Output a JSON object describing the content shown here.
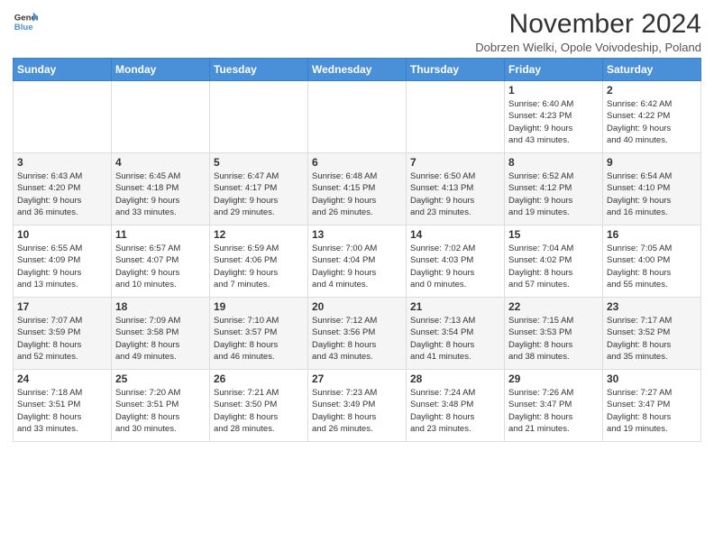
{
  "logo": {
    "line1": "General",
    "line2": "Blue"
  },
  "title": "November 2024",
  "subtitle": "Dobrzen Wielki, Opole Voivodeship, Poland",
  "days_of_week": [
    "Sunday",
    "Monday",
    "Tuesday",
    "Wednesday",
    "Thursday",
    "Friday",
    "Saturday"
  ],
  "weeks": [
    [
      {
        "day": "",
        "info": ""
      },
      {
        "day": "",
        "info": ""
      },
      {
        "day": "",
        "info": ""
      },
      {
        "day": "",
        "info": ""
      },
      {
        "day": "",
        "info": ""
      },
      {
        "day": "1",
        "info": "Sunrise: 6:40 AM\nSunset: 4:23 PM\nDaylight: 9 hours\nand 43 minutes."
      },
      {
        "day": "2",
        "info": "Sunrise: 6:42 AM\nSunset: 4:22 PM\nDaylight: 9 hours\nand 40 minutes."
      }
    ],
    [
      {
        "day": "3",
        "info": "Sunrise: 6:43 AM\nSunset: 4:20 PM\nDaylight: 9 hours\nand 36 minutes."
      },
      {
        "day": "4",
        "info": "Sunrise: 6:45 AM\nSunset: 4:18 PM\nDaylight: 9 hours\nand 33 minutes."
      },
      {
        "day": "5",
        "info": "Sunrise: 6:47 AM\nSunset: 4:17 PM\nDaylight: 9 hours\nand 29 minutes."
      },
      {
        "day": "6",
        "info": "Sunrise: 6:48 AM\nSunset: 4:15 PM\nDaylight: 9 hours\nand 26 minutes."
      },
      {
        "day": "7",
        "info": "Sunrise: 6:50 AM\nSunset: 4:13 PM\nDaylight: 9 hours\nand 23 minutes."
      },
      {
        "day": "8",
        "info": "Sunrise: 6:52 AM\nSunset: 4:12 PM\nDaylight: 9 hours\nand 19 minutes."
      },
      {
        "day": "9",
        "info": "Sunrise: 6:54 AM\nSunset: 4:10 PM\nDaylight: 9 hours\nand 16 minutes."
      }
    ],
    [
      {
        "day": "10",
        "info": "Sunrise: 6:55 AM\nSunset: 4:09 PM\nDaylight: 9 hours\nand 13 minutes."
      },
      {
        "day": "11",
        "info": "Sunrise: 6:57 AM\nSunset: 4:07 PM\nDaylight: 9 hours\nand 10 minutes."
      },
      {
        "day": "12",
        "info": "Sunrise: 6:59 AM\nSunset: 4:06 PM\nDaylight: 9 hours\nand 7 minutes."
      },
      {
        "day": "13",
        "info": "Sunrise: 7:00 AM\nSunset: 4:04 PM\nDaylight: 9 hours\nand 4 minutes."
      },
      {
        "day": "14",
        "info": "Sunrise: 7:02 AM\nSunset: 4:03 PM\nDaylight: 9 hours\nand 0 minutes."
      },
      {
        "day": "15",
        "info": "Sunrise: 7:04 AM\nSunset: 4:02 PM\nDaylight: 8 hours\nand 57 minutes."
      },
      {
        "day": "16",
        "info": "Sunrise: 7:05 AM\nSunset: 4:00 PM\nDaylight: 8 hours\nand 55 minutes."
      }
    ],
    [
      {
        "day": "17",
        "info": "Sunrise: 7:07 AM\nSunset: 3:59 PM\nDaylight: 8 hours\nand 52 minutes."
      },
      {
        "day": "18",
        "info": "Sunrise: 7:09 AM\nSunset: 3:58 PM\nDaylight: 8 hours\nand 49 minutes."
      },
      {
        "day": "19",
        "info": "Sunrise: 7:10 AM\nSunset: 3:57 PM\nDaylight: 8 hours\nand 46 minutes."
      },
      {
        "day": "20",
        "info": "Sunrise: 7:12 AM\nSunset: 3:56 PM\nDaylight: 8 hours\nand 43 minutes."
      },
      {
        "day": "21",
        "info": "Sunrise: 7:13 AM\nSunset: 3:54 PM\nDaylight: 8 hours\nand 41 minutes."
      },
      {
        "day": "22",
        "info": "Sunrise: 7:15 AM\nSunset: 3:53 PM\nDaylight: 8 hours\nand 38 minutes."
      },
      {
        "day": "23",
        "info": "Sunrise: 7:17 AM\nSunset: 3:52 PM\nDaylight: 8 hours\nand 35 minutes."
      }
    ],
    [
      {
        "day": "24",
        "info": "Sunrise: 7:18 AM\nSunset: 3:51 PM\nDaylight: 8 hours\nand 33 minutes."
      },
      {
        "day": "25",
        "info": "Sunrise: 7:20 AM\nSunset: 3:51 PM\nDaylight: 8 hours\nand 30 minutes."
      },
      {
        "day": "26",
        "info": "Sunrise: 7:21 AM\nSunset: 3:50 PM\nDaylight: 8 hours\nand 28 minutes."
      },
      {
        "day": "27",
        "info": "Sunrise: 7:23 AM\nSunset: 3:49 PM\nDaylight: 8 hours\nand 26 minutes."
      },
      {
        "day": "28",
        "info": "Sunrise: 7:24 AM\nSunset: 3:48 PM\nDaylight: 8 hours\nand 23 minutes."
      },
      {
        "day": "29",
        "info": "Sunrise: 7:26 AM\nSunset: 3:47 PM\nDaylight: 8 hours\nand 21 minutes."
      },
      {
        "day": "30",
        "info": "Sunrise: 7:27 AM\nSunset: 3:47 PM\nDaylight: 8 hours\nand 19 minutes."
      }
    ]
  ]
}
